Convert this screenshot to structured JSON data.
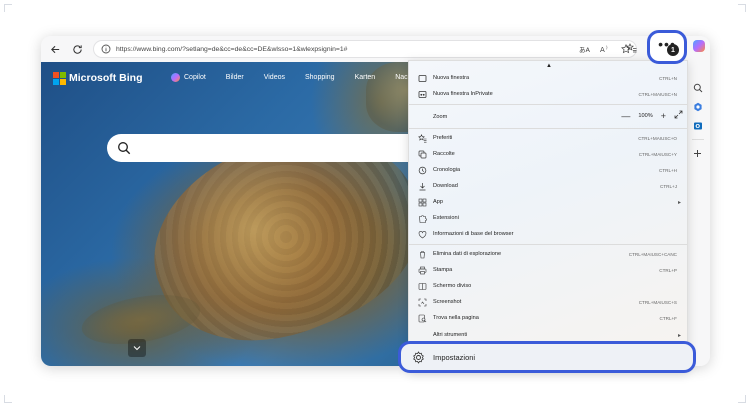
{
  "toolbar": {
    "back_icon": "arrow-left-icon",
    "refresh_icon": "refresh-icon",
    "url": "https://www.bing.com/?setlang=de&cc=de&cc=DE&wlsso=1&wlexpsignin=1#"
  },
  "bing": {
    "title": "Microsoft Bing",
    "nav": [
      "Copilot",
      "Bilder",
      "Videos",
      "Shopping",
      "Karten",
      "Nachrichten"
    ],
    "logo_colors": [
      "#f25022",
      "#7fba00",
      "#00a4ef",
      "#ffb900"
    ]
  },
  "menu": {
    "items": [
      {
        "label": "Nuova finestra",
        "shortcut": "CTRL+N",
        "icon": "new-window-icon"
      },
      {
        "label": "Nuova finestra InPrivate",
        "shortcut": "CTRL+MAIUSC+N",
        "icon": "inprivate-icon"
      },
      {
        "label": "Preferiti",
        "shortcut": "CTRL+MAIUSC+O",
        "icon": "star-list-icon"
      },
      {
        "label": "Raccolte",
        "shortcut": "CTRL+MAIUSC+Y",
        "icon": "collections-icon"
      },
      {
        "label": "Cronologia",
        "shortcut": "CTRL+H",
        "icon": "history-icon"
      },
      {
        "label": "Download",
        "shortcut": "CTRL+J",
        "icon": "download-icon"
      },
      {
        "label": "App",
        "shortcut": "",
        "icon": "apps-icon"
      },
      {
        "label": "Estensioni",
        "shortcut": "",
        "icon": "extensions-icon"
      },
      {
        "label": "Informazioni di base del browser",
        "shortcut": "",
        "icon": "browser-essentials-icon"
      },
      {
        "label": "Elimina dati di esplorazione",
        "shortcut": "CTRL+MAIUSC+CANC",
        "icon": "delete-data-icon"
      },
      {
        "label": "Stampa",
        "shortcut": "CTRL+P",
        "icon": "print-icon"
      },
      {
        "label": "Schermo diviso",
        "shortcut": "",
        "icon": "split-screen-icon"
      },
      {
        "label": "Screenshot",
        "shortcut": "CTRL+MAIUSC+S",
        "icon": "screenshot-icon"
      },
      {
        "label": "Trova nella pagina",
        "shortcut": "CTRL+F",
        "icon": "find-icon"
      },
      {
        "label": "Altri strumenti",
        "shortcut": "",
        "icon": ""
      }
    ],
    "zoom": {
      "label": "Zoom",
      "minus": "—",
      "value": "100%",
      "plus": "+",
      "fullscreen_icon": "expand-icon"
    },
    "settings_label": "Impostazioni"
  },
  "accent_color": "#3b5bd9"
}
